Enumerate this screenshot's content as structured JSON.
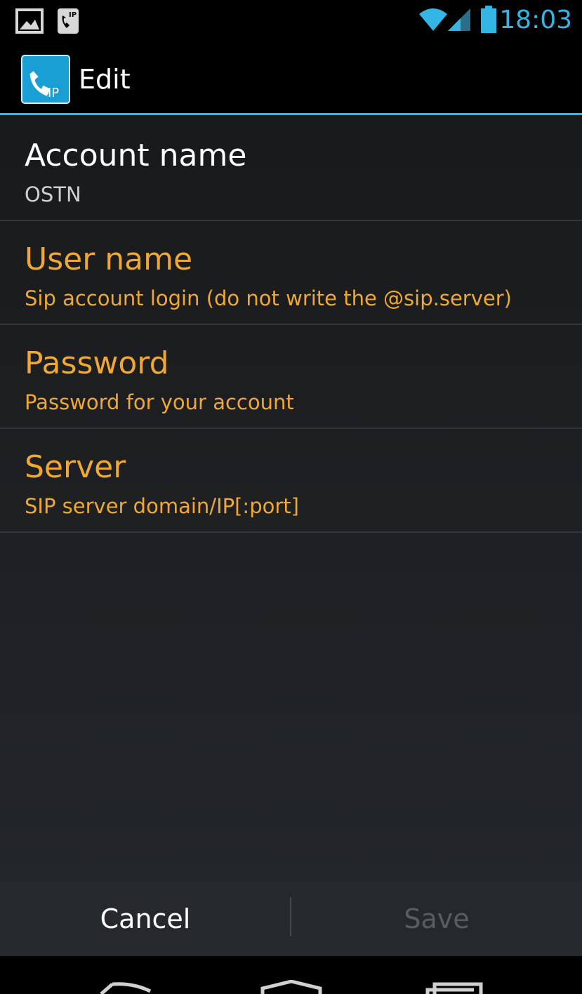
{
  "status_bar": {
    "time": "18:03",
    "icons": [
      "gallery-notification-icon",
      "sip-phone-notification-icon",
      "wifi-icon",
      "signal-icon",
      "battery-icon"
    ],
    "accent_color": "#33b5e5"
  },
  "action_bar": {
    "title": "Edit",
    "app_icon": "ip-phone-app-icon"
  },
  "preferences": [
    {
      "title": "Account name",
      "summary": "OSTN",
      "state": "enabled"
    },
    {
      "title": "User name",
      "summary": "Sip account login (do not write the @sip.server)",
      "state": "highlight"
    },
    {
      "title": "Password",
      "summary": "Password for your account",
      "state": "highlight"
    },
    {
      "title": "Server",
      "summary": "SIP server domain/IP[:port]",
      "state": "highlight"
    }
  ],
  "highlight_color": "#f0a830",
  "buttons": {
    "cancel_label": "Cancel",
    "save_label": "Save"
  },
  "nav_bar": {
    "icons": [
      "back-icon",
      "home-icon",
      "recent-apps-icon"
    ]
  }
}
